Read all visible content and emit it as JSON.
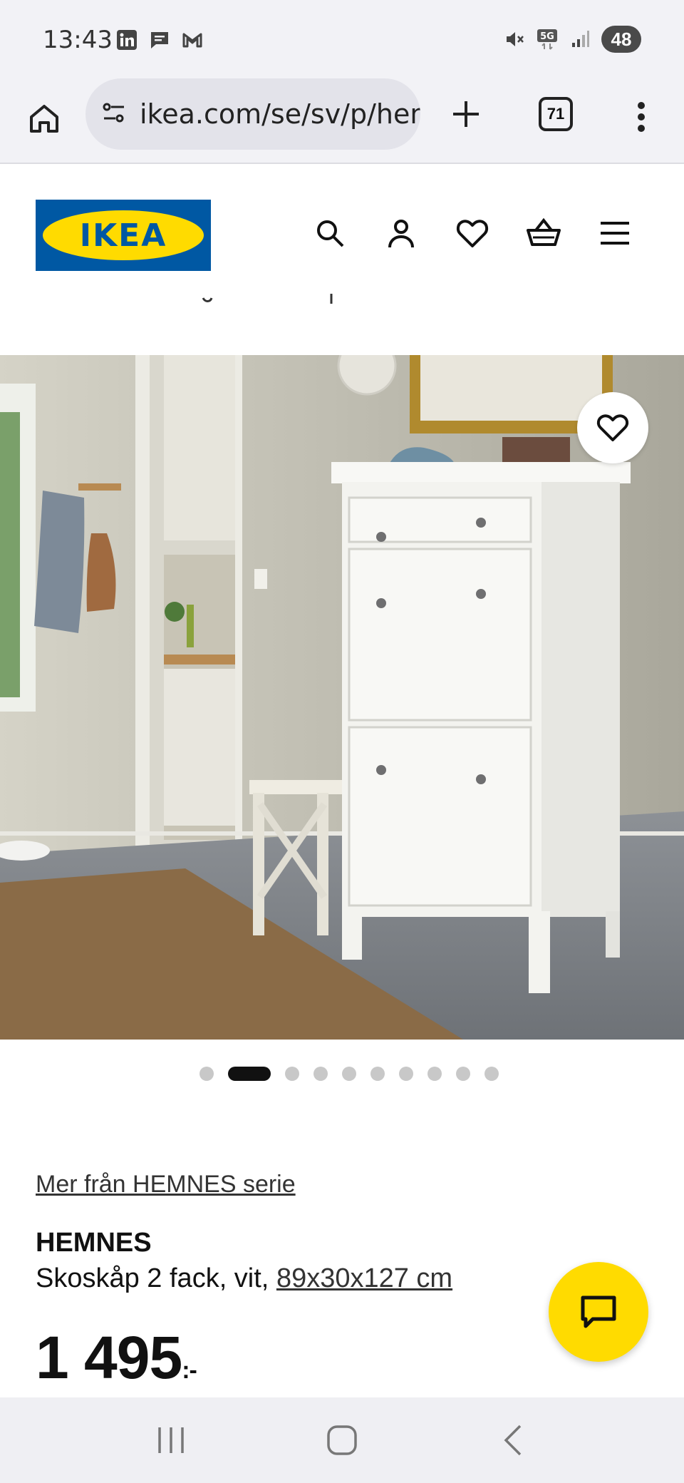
{
  "status_bar": {
    "time": "13:43",
    "battery": "48",
    "network": "5G",
    "icons_left": [
      "linkedin-icon",
      "chat-bubble-icon",
      "gmail-icon"
    ],
    "icons_right": [
      "mute-icon",
      "5g-icon",
      "signal-icon",
      "battery-icon"
    ]
  },
  "browser": {
    "url": "ikea.com/se/sv/p/hen",
    "tab_count": "71"
  },
  "header": {
    "logo_text": "IKEA",
    "icons": [
      "search-icon",
      "account-icon",
      "heart-icon",
      "cart-icon",
      "menu-icon"
    ]
  },
  "carousel": {
    "total": 10,
    "active_index": 1
  },
  "product": {
    "series_link": "Mer från HEMNES serie",
    "name": "HEMNES",
    "description": "Skoskåp 2 fack, vit,",
    "size_link": "89x30x127 cm",
    "price": "1 495",
    "price_suffix": ":-"
  },
  "colors": {
    "ikea_blue": "#0058a3",
    "ikea_yellow": "#ffdb00",
    "text": "#111111"
  }
}
